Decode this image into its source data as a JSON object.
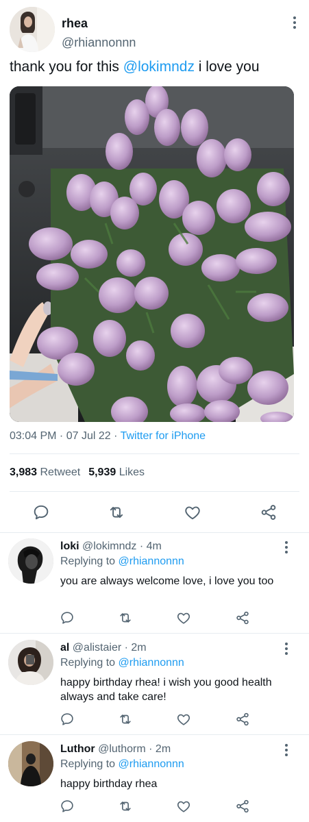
{
  "tweet": {
    "display_name": "rhea",
    "handle": "@rhiannonnn",
    "text_prefix": "thank you for this ",
    "mention": "@lokimndz",
    "text_suffix": " i love you",
    "time": "03:04 PM",
    "sep1": " · ",
    "date": "07 Jul 22",
    "sep2": " · ",
    "source": "Twitter for iPhone",
    "retweet_count": "3,983",
    "retweet_label": "Retweet",
    "like_count": "5,939",
    "like_label": "Likes"
  },
  "replies": [
    {
      "name": "loki",
      "handle": "@lokimndz",
      "time": "· 4m",
      "replying_label": "Replying to",
      "replying_to": "@rhiannonnn",
      "text": "you are always welcome love, i love you too"
    },
    {
      "name": "al",
      "handle": "@alistaier",
      "time": "· 2m",
      "replying_label": "Replying to",
      "replying_to": "@rhiannonnn",
      "text": "happy birthday rhea! i wish you good health always and take care!"
    },
    {
      "name": "Luthor",
      "handle": "@luthorm",
      "time": "· 2m",
      "replying_label": "Replying to",
      "replying_to": "@rhiannonnn",
      "text": "happy birthday rhea"
    }
  ],
  "colors": {
    "link": "#1d9bf0",
    "muted": "#536471",
    "divider": "#e6ecf0"
  },
  "icons": [
    "reply-icon",
    "retweet-icon",
    "like-icon",
    "share-icon",
    "more-icon"
  ]
}
